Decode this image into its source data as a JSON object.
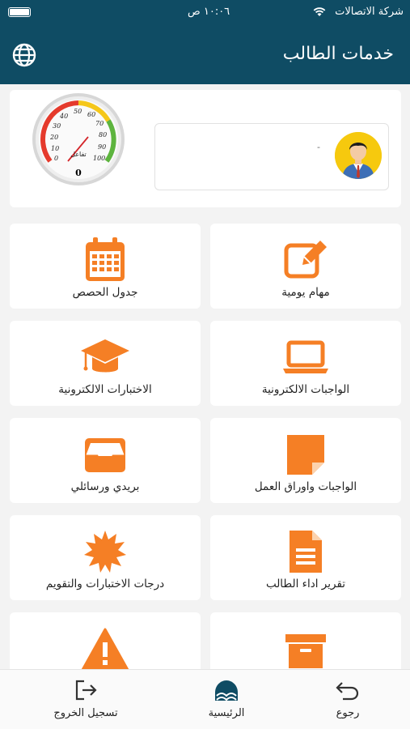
{
  "status_bar": {
    "carrier": "شركة الاتصالات",
    "time": "١٠:٠٦ ص"
  },
  "header": {
    "title": "خدمات الطالب",
    "language_icon": "globe-icon"
  },
  "profile": {
    "name": "-",
    "gauge": {
      "label": "تفاعل",
      "value": "0",
      "scale_labels": [
        "0",
        "10",
        "20",
        "30",
        "40",
        "50",
        "60",
        "70",
        "80",
        "90",
        "100"
      ]
    }
  },
  "tiles": [
    {
      "label": "مهام يومية",
      "icon": "edit-icon"
    },
    {
      "label": "جدول الحصص",
      "icon": "calendar-icon"
    },
    {
      "label": "الواجبات الالكترونية",
      "icon": "laptop-icon"
    },
    {
      "label": "الاختبارات الالكترونية",
      "icon": "graduation-cap-icon"
    },
    {
      "label": "الواجبات واوراق العمل",
      "icon": "sticky-note-icon"
    },
    {
      "label": "بريدي ورسائلي",
      "icon": "inbox-icon"
    },
    {
      "label": "تقرير اداء الطالب",
      "icon": "document-icon"
    },
    {
      "label": "درجات الاختبارات والتقويم",
      "icon": "badge-icon"
    },
    {
      "label": "",
      "icon": "archive-icon"
    },
    {
      "label": "",
      "icon": "warning-icon"
    }
  ],
  "bottom_nav": {
    "back": "رجوع",
    "home": "الرئيسية",
    "logout": "تسجيل الخروج"
  },
  "colors": {
    "header": "#0f4c64",
    "accent": "#f57f25"
  }
}
